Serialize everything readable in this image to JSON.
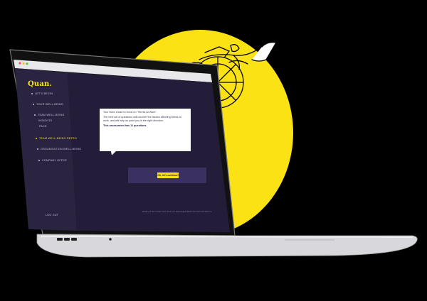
{
  "app": {
    "brand": "Quan."
  },
  "sidebar": {
    "items": [
      {
        "label": "LET'S BEGIN"
      },
      {
        "label": "YOUR WELL-BEING"
      },
      {
        "label": "TEAM WELL-BEING"
      },
      {
        "label": "INSIGHTS"
      },
      {
        "label": "PACE"
      },
      {
        "label": "TEAM WELL-BEING RETRO",
        "active": true
      },
      {
        "label": "ORGANISATION WELL-BEING"
      },
      {
        "label": "COMPANY OFFER"
      }
    ],
    "logout_label": "LOG OUT"
  },
  "popup": {
    "line1": "Your team chose to focus on \"Stress At Work\".",
    "line2": "The next set of questions will uncover the factors affecting stress at work, and will help us point you in the right direction.",
    "line3": "This assessment has 11 questions."
  },
  "main": {
    "cta_label": "Ok, let's continue!",
    "footer_note": "Would you like to know more about your assessment? Read more here and about us."
  },
  "colors": {
    "accent": "#fbe214",
    "sidebar": "#2a2440",
    "main": "#231d3a"
  }
}
